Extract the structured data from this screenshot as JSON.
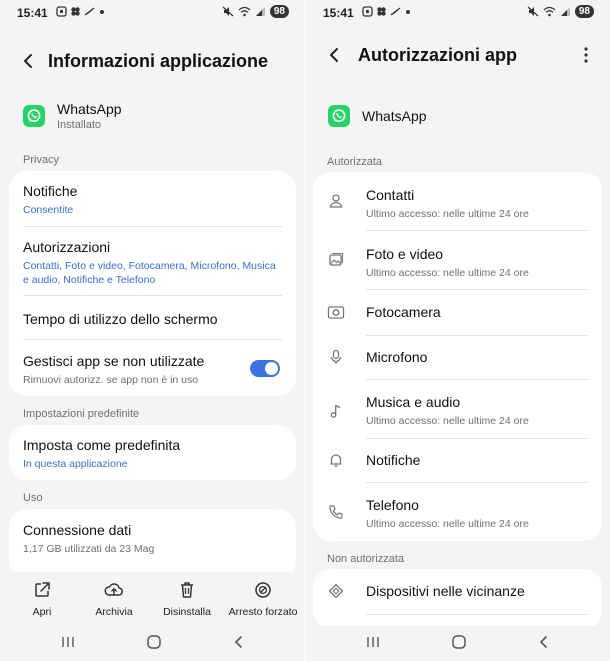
{
  "status_bar": {
    "time": "15:41",
    "battery": "98"
  },
  "left": {
    "title": "Informazioni applicazione",
    "app": {
      "name": "WhatsApp",
      "status": "Installato"
    },
    "sections": {
      "privacy": "Privacy",
      "default": "Impostazioni predefinite",
      "usage": "Uso"
    },
    "privacy_items": {
      "notifications": {
        "title": "Notifiche",
        "sub": "Consentite"
      },
      "permissions": {
        "title": "Autorizzazioni",
        "sub": "Contatti, Foto e video, Fotocamera, Microfono, Musica e audio, Notifiche e Telefono"
      },
      "screen_time": {
        "title": "Tempo di utilizzo dello schermo"
      },
      "manage_unused": {
        "title": "Gestisci app se non utilizzate",
        "sub": "Rimuovi autorizz. se app non è in uso",
        "enabled": true
      }
    },
    "default_item": {
      "title": "Imposta come predefinita",
      "sub": "In questa applicazione"
    },
    "usage_item": {
      "title": "Connessione dati",
      "sub": "1,17 GB utilizzati da 23 Mag"
    },
    "actions": {
      "open": "Apri",
      "archive": "Archivia",
      "uninstall": "Disinstalla",
      "force_stop": "Arresto forzato"
    }
  },
  "right": {
    "title": "Autorizzazioni app",
    "app": {
      "name": "WhatsApp"
    },
    "sections": {
      "allowed": "Autorizzata",
      "denied": "Non autorizzata"
    },
    "allowed": [
      {
        "title": "Contatti",
        "sub": "Ultimo accesso: nelle ultime 24 ore",
        "icon": "person-icon"
      },
      {
        "title": "Foto e video",
        "sub": "Ultimo accesso: nelle ultime 24 ore",
        "icon": "image-icon"
      },
      {
        "title": "Fotocamera",
        "sub": "",
        "icon": "camera-icon"
      },
      {
        "title": "Microfono",
        "sub": "",
        "icon": "microphone-icon"
      },
      {
        "title": "Musica e audio",
        "sub": "Ultimo accesso: nelle ultime 24 ore",
        "icon": "music-note-icon"
      },
      {
        "title": "Notifiche",
        "sub": "",
        "icon": "bell-icon"
      },
      {
        "title": "Telefono",
        "sub": "Ultimo accesso: nelle ultime 24 ore",
        "icon": "phone-icon"
      }
    ],
    "denied": [
      {
        "title": "Dispositivi nelle vicinanze",
        "icon": "nearby-devices-icon"
      }
    ]
  },
  "colors": {
    "accent": "#3b73e0",
    "link": "#3a6ed4",
    "whatsapp": "#25d366"
  }
}
